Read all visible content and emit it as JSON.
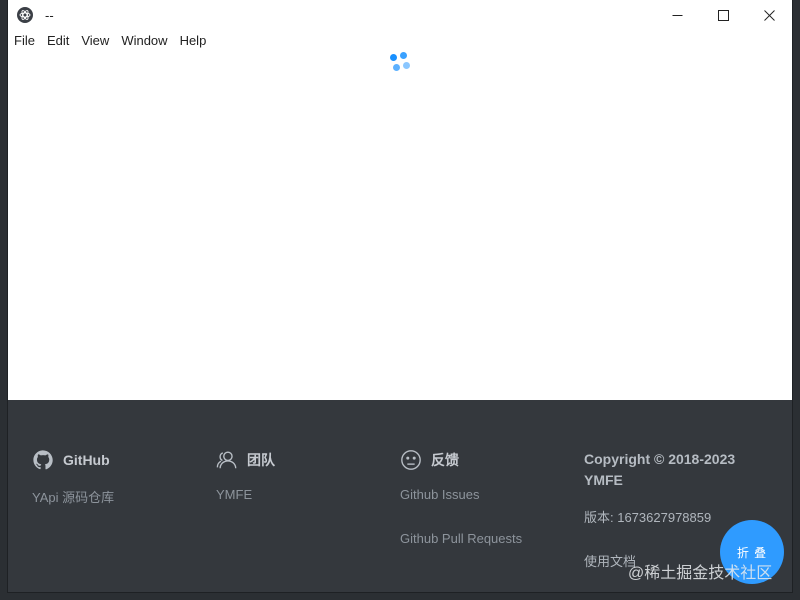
{
  "window": {
    "title": "--",
    "controls": [
      "minimize-icon",
      "maximize-icon",
      "close-icon"
    ]
  },
  "menu": {
    "items": [
      "File",
      "Edit",
      "View",
      "Window",
      "Help"
    ]
  },
  "content": {
    "spinner_color": "#1890ff",
    "state": "loading"
  },
  "footer": {
    "github": {
      "title": "GitHub",
      "icon": "github-icon",
      "links": [
        "YApi 源码仓库"
      ]
    },
    "team": {
      "title": "团队",
      "icon": "team-icon",
      "links": [
        "YMFE"
      ]
    },
    "feedback": {
      "title": "反馈",
      "icon": "feedback-icon",
      "links": [
        "Github Issues",
        "Github Pull Requests"
      ]
    },
    "copyright": "Copyright © 2018-2023 YMFE",
    "version": "版本: 1673627978859",
    "docs": "使用文档",
    "fold_button": "折 叠",
    "watermark": "@稀土掘金技术社区"
  },
  "colors": {
    "footer_bg": "#34383d",
    "accent": "#2f9bff",
    "page_bg": "#2b2f33"
  }
}
